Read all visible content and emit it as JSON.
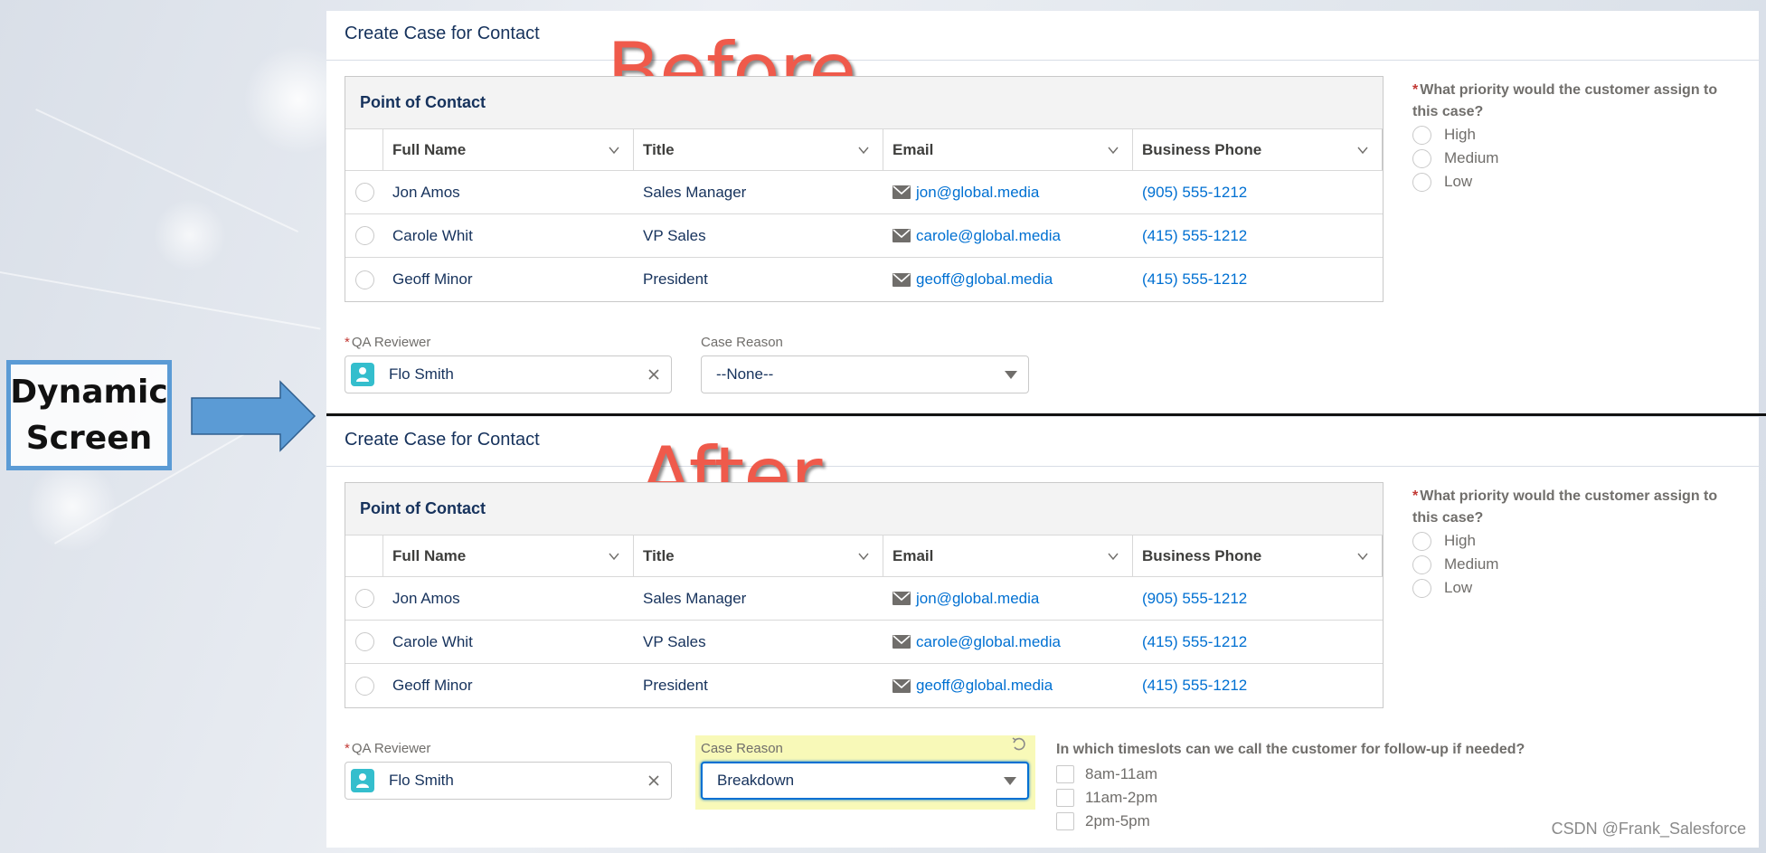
{
  "annotation": {
    "callout_line1": "Dynamic",
    "callout_line2": "Screen",
    "before_label": "Before",
    "after_label": "After"
  },
  "screens": {
    "before": {
      "title": "Create Case for Contact",
      "table_title": "Point of Contact",
      "columns": [
        "Full Name",
        "Title",
        "Email",
        "Business Phone"
      ],
      "rows": [
        {
          "name": "Jon Amos",
          "title": "Sales Manager",
          "email": "jon@global.media",
          "phone": "(905) 555-1212"
        },
        {
          "name": "Carole Whit",
          "title": "VP Sales",
          "email": "carole@global.media",
          "phone": "(415) 555-1212"
        },
        {
          "name": "Geoff Minor",
          "title": "President",
          "email": "geoff@global.media",
          "phone": "(415) 555-1212"
        }
      ],
      "priority_question": "What priority would the customer assign to this case?",
      "priority_options": [
        "High",
        "Medium",
        "Low"
      ],
      "qa_reviewer_label": "QA Reviewer",
      "qa_reviewer_value": "Flo Smith",
      "case_reason_label": "Case Reason",
      "case_reason_value": "--None--"
    },
    "after": {
      "title": "Create Case for Contact",
      "table_title": "Point of Contact",
      "columns": [
        "Full Name",
        "Title",
        "Email",
        "Business Phone"
      ],
      "rows": [
        {
          "name": "Jon Amos",
          "title": "Sales Manager",
          "email": "jon@global.media",
          "phone": "(905) 555-1212"
        },
        {
          "name": "Carole Whit",
          "title": "VP Sales",
          "email": "carole@global.media",
          "phone": "(415) 555-1212"
        },
        {
          "name": "Geoff Minor",
          "title": "President",
          "email": "geoff@global.media",
          "phone": "(415) 555-1212"
        }
      ],
      "priority_question": "What priority would the customer assign to this case?",
      "priority_options": [
        "High",
        "Medium",
        "Low"
      ],
      "qa_reviewer_label": "QA Reviewer",
      "qa_reviewer_value": "Flo Smith",
      "case_reason_label": "Case Reason",
      "case_reason_value": "Breakdown",
      "timeslot_question": "In which timeslots can we call the customer for follow-up if needed?",
      "timeslot_options": [
        "8am-11am",
        "11am-2pm",
        "2pm-5pm"
      ]
    }
  },
  "watermark": "CSDN @Frank_Salesforce",
  "colors": {
    "title_navy": "#16325c",
    "link_blue": "#0070d2",
    "annotation_red": "#ef5a4b",
    "callout_blue": "#5b9bd5",
    "changed_highlight": "#f8f9b8",
    "avatar_teal": "#34becd",
    "required_red": "#c23934"
  }
}
